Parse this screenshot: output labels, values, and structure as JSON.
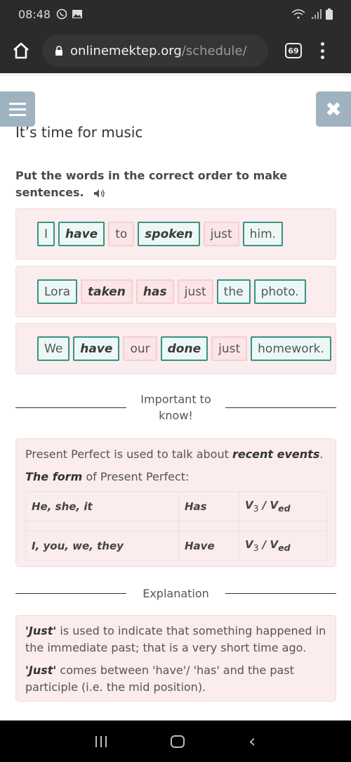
{
  "statusbar": {
    "time": "08:48",
    "icons": [
      "whatsapp-icon",
      "image-icon",
      "wifi-icon",
      "signal-icon",
      "battery-icon"
    ]
  },
  "browser": {
    "url_domain": "onlinemektep.org",
    "url_path": "/schedule/",
    "tab_count": "69"
  },
  "page": {
    "title": "It’s time for music",
    "instruction": "Put the words in the correct order to make sentences.",
    "exercises": [
      {
        "words": [
          {
            "text": "I",
            "state": "correct",
            "bold": false
          },
          {
            "text": "have",
            "state": "correct",
            "bold": true
          },
          {
            "text": "to",
            "state": "neutral",
            "bold": false
          },
          {
            "text": "spoken",
            "state": "correct",
            "bold": true
          },
          {
            "text": "just",
            "state": "neutral",
            "bold": false
          },
          {
            "text": "him.",
            "state": "correct",
            "bold": false
          }
        ]
      },
      {
        "words": [
          {
            "text": "Lora",
            "state": "correct",
            "bold": false
          },
          {
            "text": "taken",
            "state": "neutral",
            "bold": true
          },
          {
            "text": "has",
            "state": "neutral",
            "bold": true
          },
          {
            "text": "just",
            "state": "neutral",
            "bold": false
          },
          {
            "text": "the",
            "state": "correct",
            "bold": false
          },
          {
            "text": "photo.",
            "state": "correct",
            "bold": false
          }
        ]
      },
      {
        "words": [
          {
            "text": "We",
            "state": "correct",
            "bold": false
          },
          {
            "text": "have",
            "state": "correct",
            "bold": true
          },
          {
            "text": "our",
            "state": "neutral",
            "bold": false
          },
          {
            "text": "done",
            "state": "correct",
            "bold": true
          },
          {
            "text": "just",
            "state": "neutral",
            "bold": false
          },
          {
            "text": "homework.",
            "state": "correct",
            "bold": false
          }
        ]
      }
    ],
    "important_label_1": "Important to",
    "important_label_2": "know!",
    "info": {
      "line1_pre": "Present Perfect is used to talk about ",
      "line1_bold": "recent events",
      "line1_post": ".",
      "line2_bold": "The form",
      "line2_post": " of Present Perfect:",
      "table": [
        {
          "subject": "He, she, it",
          "aux": "Has",
          "verb": "V3 / Ved"
        },
        {
          "subject": "I, you, we, they",
          "aux": "Have",
          "verb": "V3 / Ved"
        }
      ]
    },
    "explanation_label": "Explanation",
    "explanation": {
      "p1_bold": "'Just'",
      "p1_text": " is used to indicate that something happened in the immediate past; that is a very short time ago.",
      "p2_bold": "'Just'",
      "p2_text": " comes between 'have'/ 'has' and the past participle (i.e. the mid position)."
    }
  },
  "colors": {
    "correct_border": "#3a9185",
    "neutral_border": "#f3d0d2",
    "panel_bg": "#fbeced",
    "menu_button": "#9eb3bf"
  }
}
